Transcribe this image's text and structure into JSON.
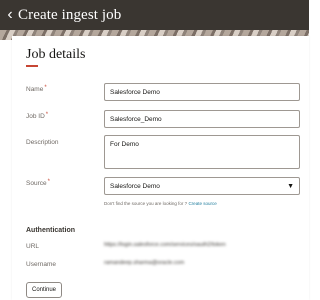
{
  "header": {
    "back_icon": "chevron-left-icon",
    "title": "Create ingest job",
    "background": "#3a3631"
  },
  "section": {
    "title": "Job details",
    "accent": "#c74634"
  },
  "fields": {
    "name": {
      "label": "Name",
      "required": "*",
      "value": "Salesforce Demo"
    },
    "job_id": {
      "label": "Job ID",
      "required": "*",
      "value": "Salesforce_Demo"
    },
    "description": {
      "label": "Description",
      "value": "For Demo"
    },
    "source": {
      "label": "Source",
      "required": "*",
      "value": "Salesforce Demo",
      "icon": "chevron-down-icon"
    }
  },
  "hint": {
    "text": "Don't find the source you are looking for ?",
    "link": "Create source"
  },
  "authentication": {
    "title": "Authentication",
    "url_label": "URL",
    "url_value": "https://login.salesforce.com/services/oauth2/token",
    "username_label": "Username",
    "username_value": "ramandeep.sharma@oracle.com"
  },
  "actions": {
    "continue_label": "Continue"
  }
}
